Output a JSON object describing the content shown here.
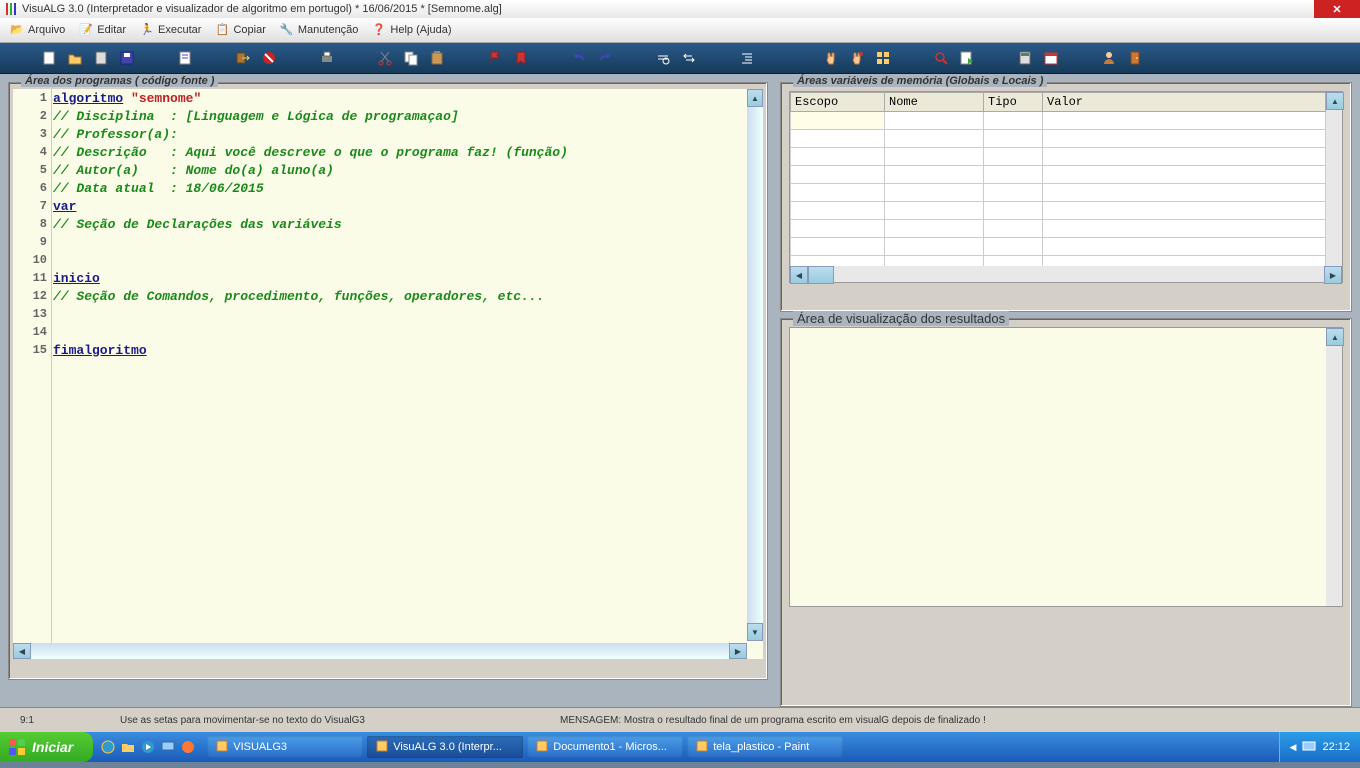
{
  "title": "VisuALG 3.0  (Interpretador e visualizador de algoritmo em portugol) * 16/06/2015 * [Semnome.alg]",
  "menu": {
    "arquivo": "Arquivo",
    "editar": "Editar",
    "executar": "Executar",
    "copiar": "Copiar",
    "manutencao": "Manutenção",
    "help": "Help (Ajuda)"
  },
  "panels": {
    "code": "Área dos programas ( código fonte )",
    "vars": "Áreas variáveis de memória (Globais e Locais )",
    "results": "Área de visualização dos resultados"
  },
  "code_lines": [
    {
      "n": 1,
      "seg": [
        {
          "t": "algoritmo",
          "c": "kw"
        },
        {
          "t": " "
        },
        {
          "t": "\"semnome\"",
          "c": "str"
        }
      ]
    },
    {
      "n": 2,
      "seg": [
        {
          "t": "// Disciplina  : [Linguagem e Lógica de programaçao]",
          "c": "com"
        }
      ]
    },
    {
      "n": 3,
      "seg": [
        {
          "t": "// Professor(a):",
          "c": "com"
        }
      ]
    },
    {
      "n": 4,
      "seg": [
        {
          "t": "// Descrição   : Aqui você descreve o que o programa faz! (função)",
          "c": "com"
        }
      ]
    },
    {
      "n": 5,
      "seg": [
        {
          "t": "// Autor(a)    : Nome do(a) aluno(a)",
          "c": "com"
        }
      ]
    },
    {
      "n": 6,
      "seg": [
        {
          "t": "// Data atual  : 18/06/2015",
          "c": "com"
        }
      ]
    },
    {
      "n": 7,
      "seg": [
        {
          "t": "var",
          "c": "kw"
        }
      ]
    },
    {
      "n": 8,
      "seg": [
        {
          "t": "// Seção de Declarações das variáveis",
          "c": "com"
        }
      ]
    },
    {
      "n": 9,
      "seg": []
    },
    {
      "n": 10,
      "seg": []
    },
    {
      "n": 11,
      "seg": [
        {
          "t": "inicio",
          "c": "kw"
        }
      ]
    },
    {
      "n": 12,
      "seg": [
        {
          "t": "// Seção de Comandos, procedimento, funções, operadores, etc...",
          "c": "com"
        }
      ]
    },
    {
      "n": 13,
      "seg": []
    },
    {
      "n": 14,
      "seg": []
    },
    {
      "n": 15,
      "seg": [
        {
          "t": "fimalgoritmo",
          "c": "kw"
        }
      ]
    }
  ],
  "var_headers": {
    "escopo": "Escopo",
    "nome": "Nome",
    "tipo": "Tipo",
    "valor": "Valor"
  },
  "status": {
    "pos": "9:1",
    "hint": "Use as setas para movimentar-se no texto do VisualG3",
    "msg": "MENSAGEM: Mostra o resultado final de um programa escrito em visualG depois de finalizado !"
  },
  "taskbar": {
    "start": "Iniciar",
    "items": [
      {
        "label": "VISUALG3",
        "active": false
      },
      {
        "label": "VisuALG 3.0  (Interpr...",
        "active": true
      },
      {
        "label": "Documento1 - Micros...",
        "active": false
      },
      {
        "label": "tela_plastico - Paint",
        "active": false
      }
    ],
    "clock": "22:12"
  }
}
